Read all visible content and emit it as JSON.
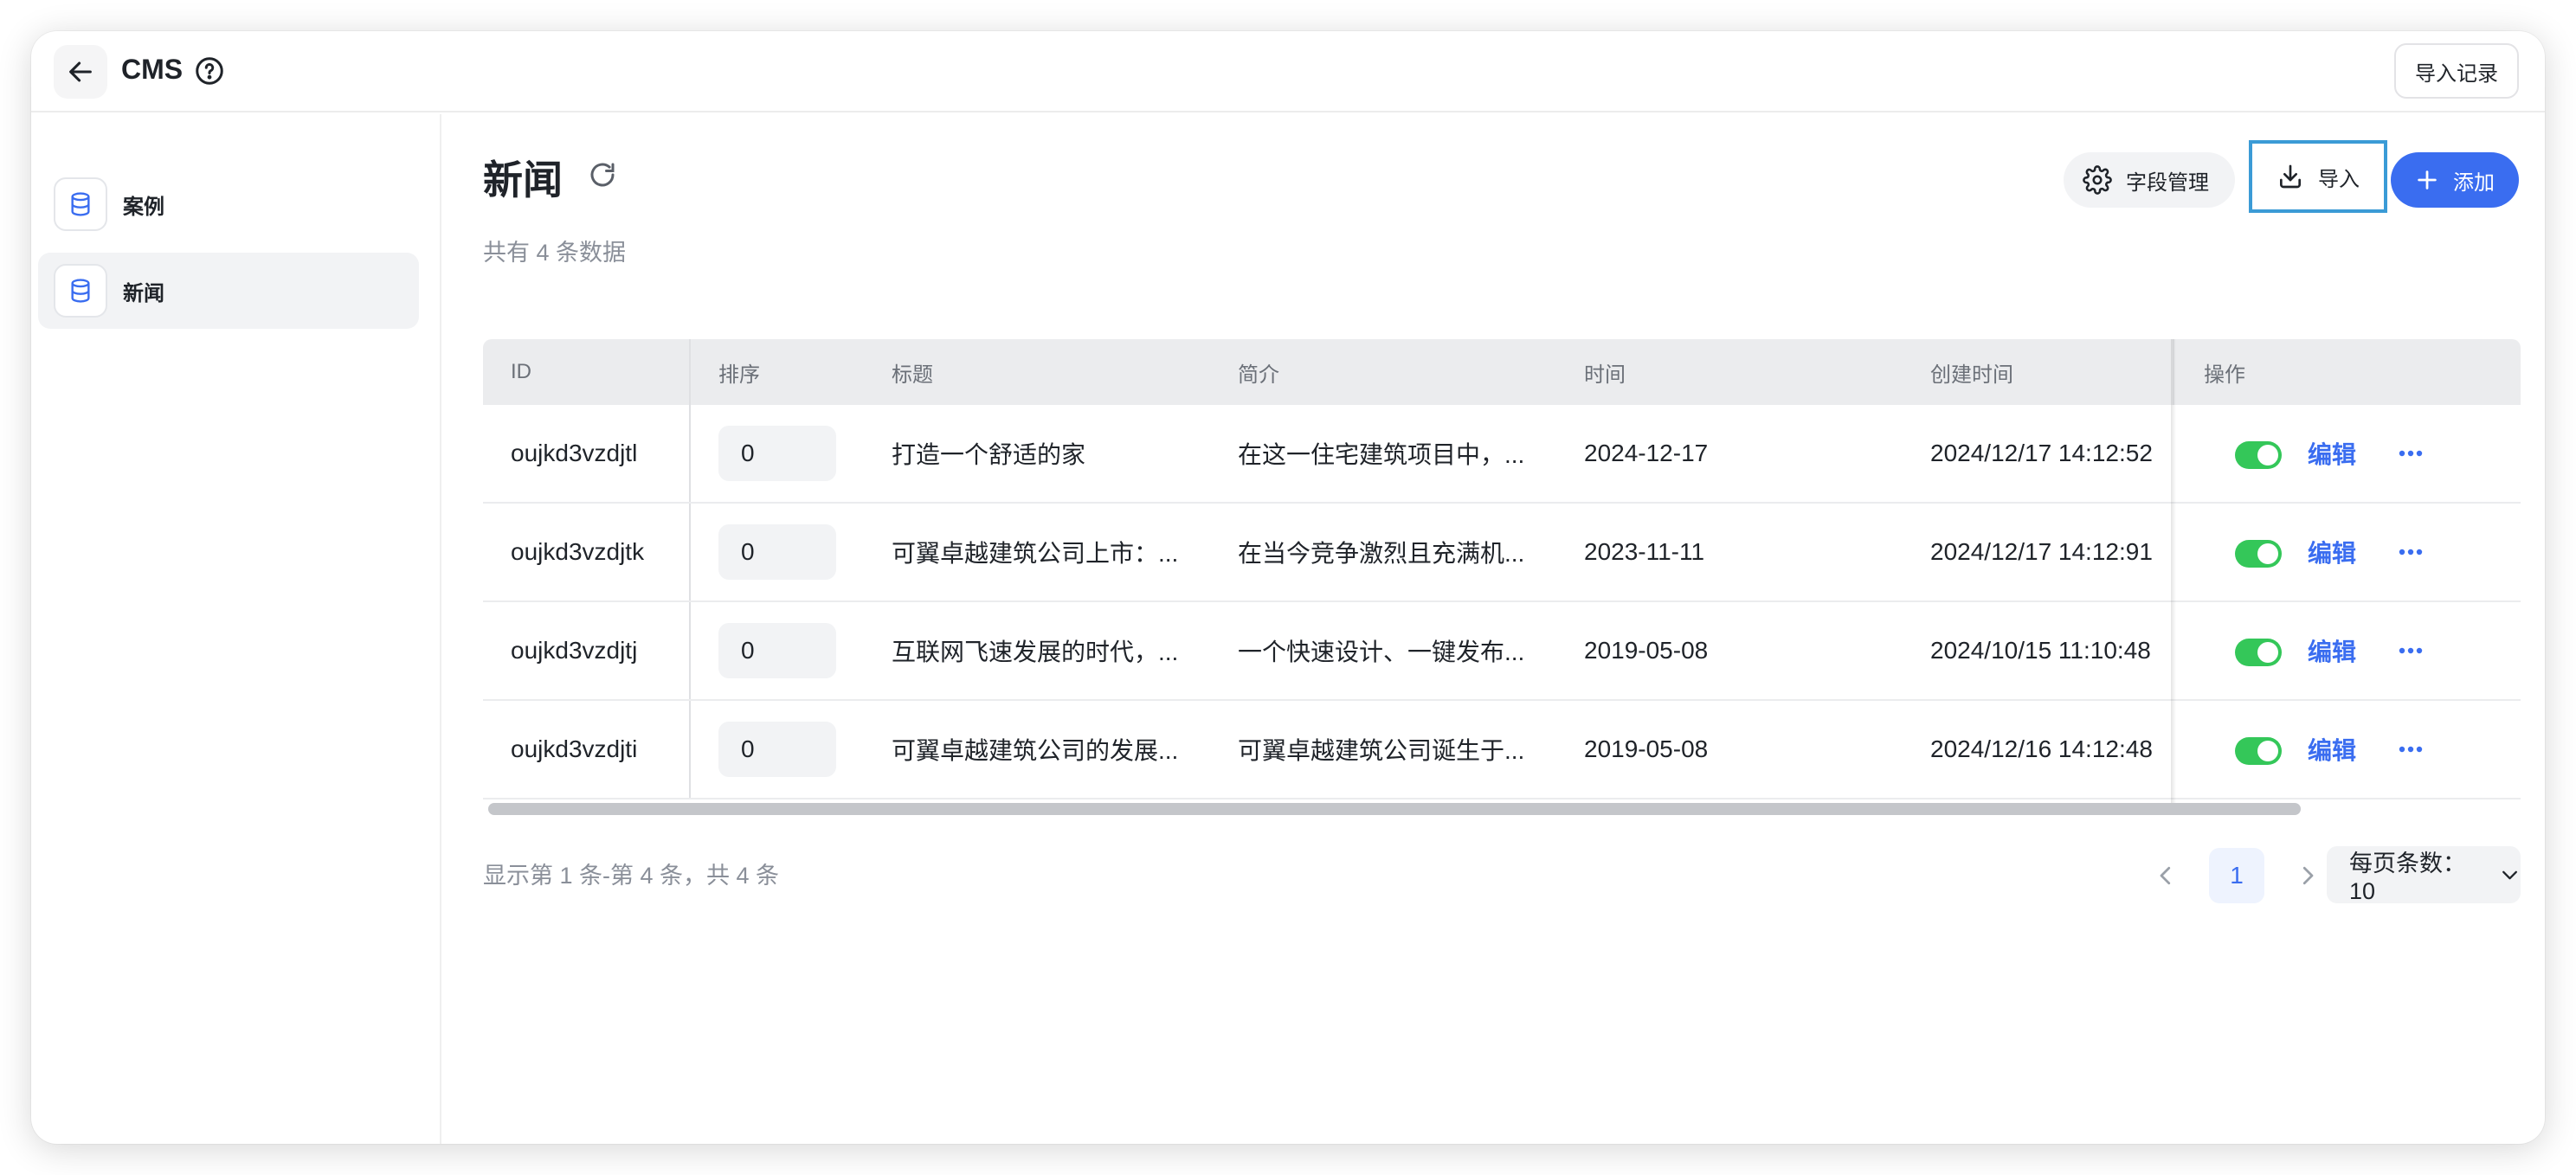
{
  "app": {
    "title": "CMS"
  },
  "header": {
    "import_log_label": "导入记录"
  },
  "sidebar": {
    "items": [
      {
        "label": "案例",
        "icon": "database-icon",
        "active": false
      },
      {
        "label": "新闻",
        "icon": "database-icon",
        "active": true
      }
    ]
  },
  "page": {
    "title": "新闻",
    "count_text": "共有 4 条数据",
    "buttons": {
      "fields": "字段管理",
      "import": "导入",
      "add": "添加"
    }
  },
  "table": {
    "columns": [
      "ID",
      "排序",
      "标题",
      "简介",
      "时间",
      "创建时间",
      "操作"
    ],
    "rows": [
      {
        "id": "oujkd3vzdjtl",
        "order": "0",
        "title": "打造一个舒适的家",
        "summary": "在这一住宅建筑项目中，...",
        "date": "2024-12-17",
        "created": "2024/12/17 14:12:52",
        "enabled": true,
        "edit": "编辑"
      },
      {
        "id": "oujkd3vzdjtk",
        "order": "0",
        "title": "可翼卓越建筑公司上市：...",
        "summary": "在当今竞争激烈且充满机...",
        "date": "2023-11-11",
        "created": "2024/12/17 14:12:91",
        "enabled": true,
        "edit": "编辑"
      },
      {
        "id": "oujkd3vzdjtj",
        "order": "0",
        "title": "互联网飞速发展的时代，...",
        "summary": "一个快速设计、一键发布...",
        "date": "2019-05-08",
        "created": "2024/10/15 11:10:48",
        "enabled": true,
        "edit": "编辑"
      },
      {
        "id": "oujkd3vzdjti",
        "order": "0",
        "title": "可翼卓越建筑公司的发展...",
        "summary": "可翼卓越建筑公司诞生于...",
        "date": "2019-05-08",
        "created": "2024/12/16 14:12:48",
        "enabled": true,
        "edit": "编辑"
      }
    ]
  },
  "pagination": {
    "summary": "显示第 1 条-第 4 条，共 4 条",
    "current_page": "1",
    "page_size_label": "每页条数：10"
  },
  "colors": {
    "accent": "#3a6df0",
    "toggle_on": "#34c759",
    "highlight_border": "#3b9bd6"
  }
}
